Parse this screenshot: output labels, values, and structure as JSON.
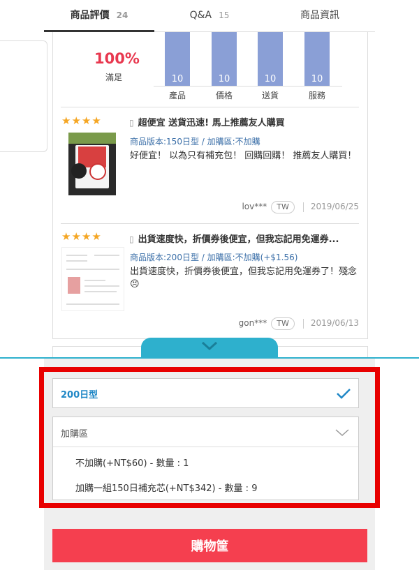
{
  "tabs": [
    {
      "label": "商品評價",
      "count": "24"
    },
    {
      "label": "Q&A",
      "count": "15"
    },
    {
      "label": "商品資訊",
      "count": ""
    }
  ],
  "summary": {
    "percent": "100%",
    "label": "滿足",
    "chart_data": {
      "type": "bar",
      "categories": [
        "產品",
        "價格",
        "送貨",
        "服務"
      ],
      "values": [
        10,
        10,
        10,
        10
      ],
      "colors": [
        "#8a9fd6"
      ]
    }
  },
  "reviews": [
    {
      "stars": "★★★★",
      "title": "超便宜 送貨迅速! 馬上推薦友人購買",
      "variant": "商品版本:150日型 / 加購區:不加購",
      "body": "好便宜！ 以為只有補充包！ 回購回購！ 推薦友人購買！",
      "user": "lov***",
      "region": "TW",
      "date": "2019/06/25"
    },
    {
      "stars": "★★★★",
      "title": "出貨速度快，折價券後便宜，但我忘記用免運券...",
      "variant": "商品版本:200日型 / 加購區:不加購(+$1.56)",
      "body": "出貨速度快，折價券後便宜，但我忘記用免運券了！殘念😣",
      "user": "gon***",
      "region": "TW",
      "date": "2019/06/13"
    }
  ],
  "options": {
    "selected_variant": "200日型",
    "addon_label": "加購區",
    "addon_items": [
      "不加購(+NT$60) - 數量 : 1",
      "加購一組150日補充芯(+NT$342) - 數量 : 9"
    ]
  },
  "cart_button": "購物筐",
  "colors": {
    "accent_red": "#f53f4f",
    "highlight": "#e80000",
    "blue": "#1f87c6",
    "cyan": "#2eb0cd",
    "bar": "#8a9fd6",
    "star": "#f5a623"
  }
}
